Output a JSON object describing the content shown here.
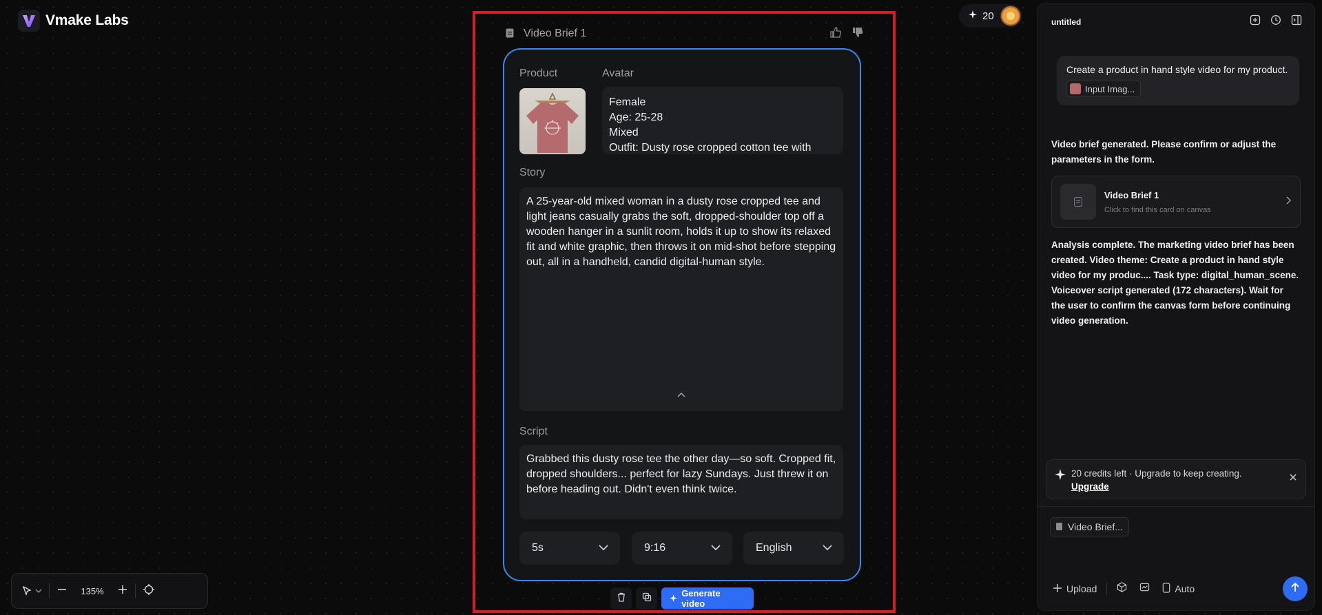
{
  "app": {
    "name": "Vmake Labs"
  },
  "topbar": {
    "credits": "20"
  },
  "canvas": {
    "zoom": "135%",
    "card": {
      "title": "Video Brief 1",
      "product_label": "Product",
      "avatar_label": "Avatar",
      "avatar_lines": [
        "Female",
        "Age: 25-28",
        "Mixed",
        "Outfit: Dusty rose cropped cotton tee with"
      ],
      "story_label": "Story",
      "story_text": "A 25-year-old mixed woman in a dusty rose cropped tee and light jeans casually grabs the soft, dropped-shoulder top off a wooden hanger in a sunlit room, holds it up to show its relaxed fit and white graphic, then throws it on mid-shot before stepping out, all in a handheld, candid digital-human style.",
      "script_label": "Script",
      "script_text": "Grabbed this dusty rose tee the other day—so soft. Cropped fit, dropped shoulders... perfect for lazy Sundays. Just threw it on before heading out. Didn't even think twice.",
      "duration": "5s",
      "aspect_ratio": "9:16",
      "language": "English"
    },
    "toolbar": {
      "generate_label": "Generate video"
    }
  },
  "panel": {
    "title": "untitled",
    "user_message": "Create a product in hand style video for my product.",
    "attachment_label": "Input Imag...",
    "assistant_intro": "Video brief generated. Please confirm or adjust the parameters in the form.",
    "brief_card": {
      "title": "Video Brief 1",
      "subtitle": "Click to find this card on canvas"
    },
    "assistant_summary": "Analysis complete. The marketing video brief has been created. Video theme: Create a product in hand style video for my produc.... Task type: digital_human_scene. Voiceover script generated (172 characters). Wait for the user to confirm the canvas form before continuing video generation.",
    "credit_notice": {
      "text": "20 credits left · Upgrade to keep creating.",
      "link": "Upgrade"
    },
    "context_chip": "Video Brief...",
    "composer": {
      "upload_label": "Upload",
      "mode_label": "Auto"
    }
  },
  "colors": {
    "accent": "#2f6cf6",
    "selection": "#d41f26",
    "card_border": "#3f86f0"
  }
}
